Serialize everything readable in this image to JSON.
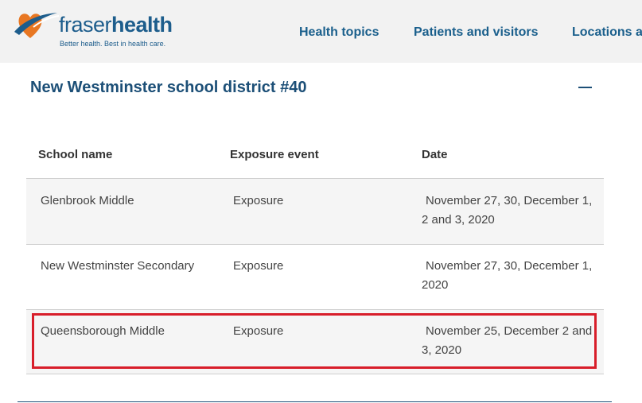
{
  "brand": {
    "name_light": "fraser",
    "name_bold": "health",
    "tagline": "Better health. Best in health care.",
    "colors": {
      "primary": "#1d5d8c",
      "accent_orange": "#e87722",
      "highlight_red": "#d81e2a"
    }
  },
  "nav": {
    "items": [
      {
        "label": "Health topics"
      },
      {
        "label": "Patients and visitors"
      },
      {
        "label": "Locations a"
      }
    ]
  },
  "section": {
    "title": "New Westminster school district #40",
    "toggle_icon": "minus-icon"
  },
  "table": {
    "headers": [
      "School name",
      "Exposure event",
      "Date"
    ],
    "rows": [
      {
        "school": "Glenbrook Middle",
        "event": "Exposure",
        "date": "November 27, 30, December 1, 2 and 3, 2020"
      },
      {
        "school": "New Westminster Secondary",
        "event": "Exposure",
        "date": "November 27, 30, December 1, 2020"
      },
      {
        "school": "Queensborough Middle",
        "event": "Exposure",
        "date": "November 25, December 2 and 3, 2020"
      }
    ]
  }
}
